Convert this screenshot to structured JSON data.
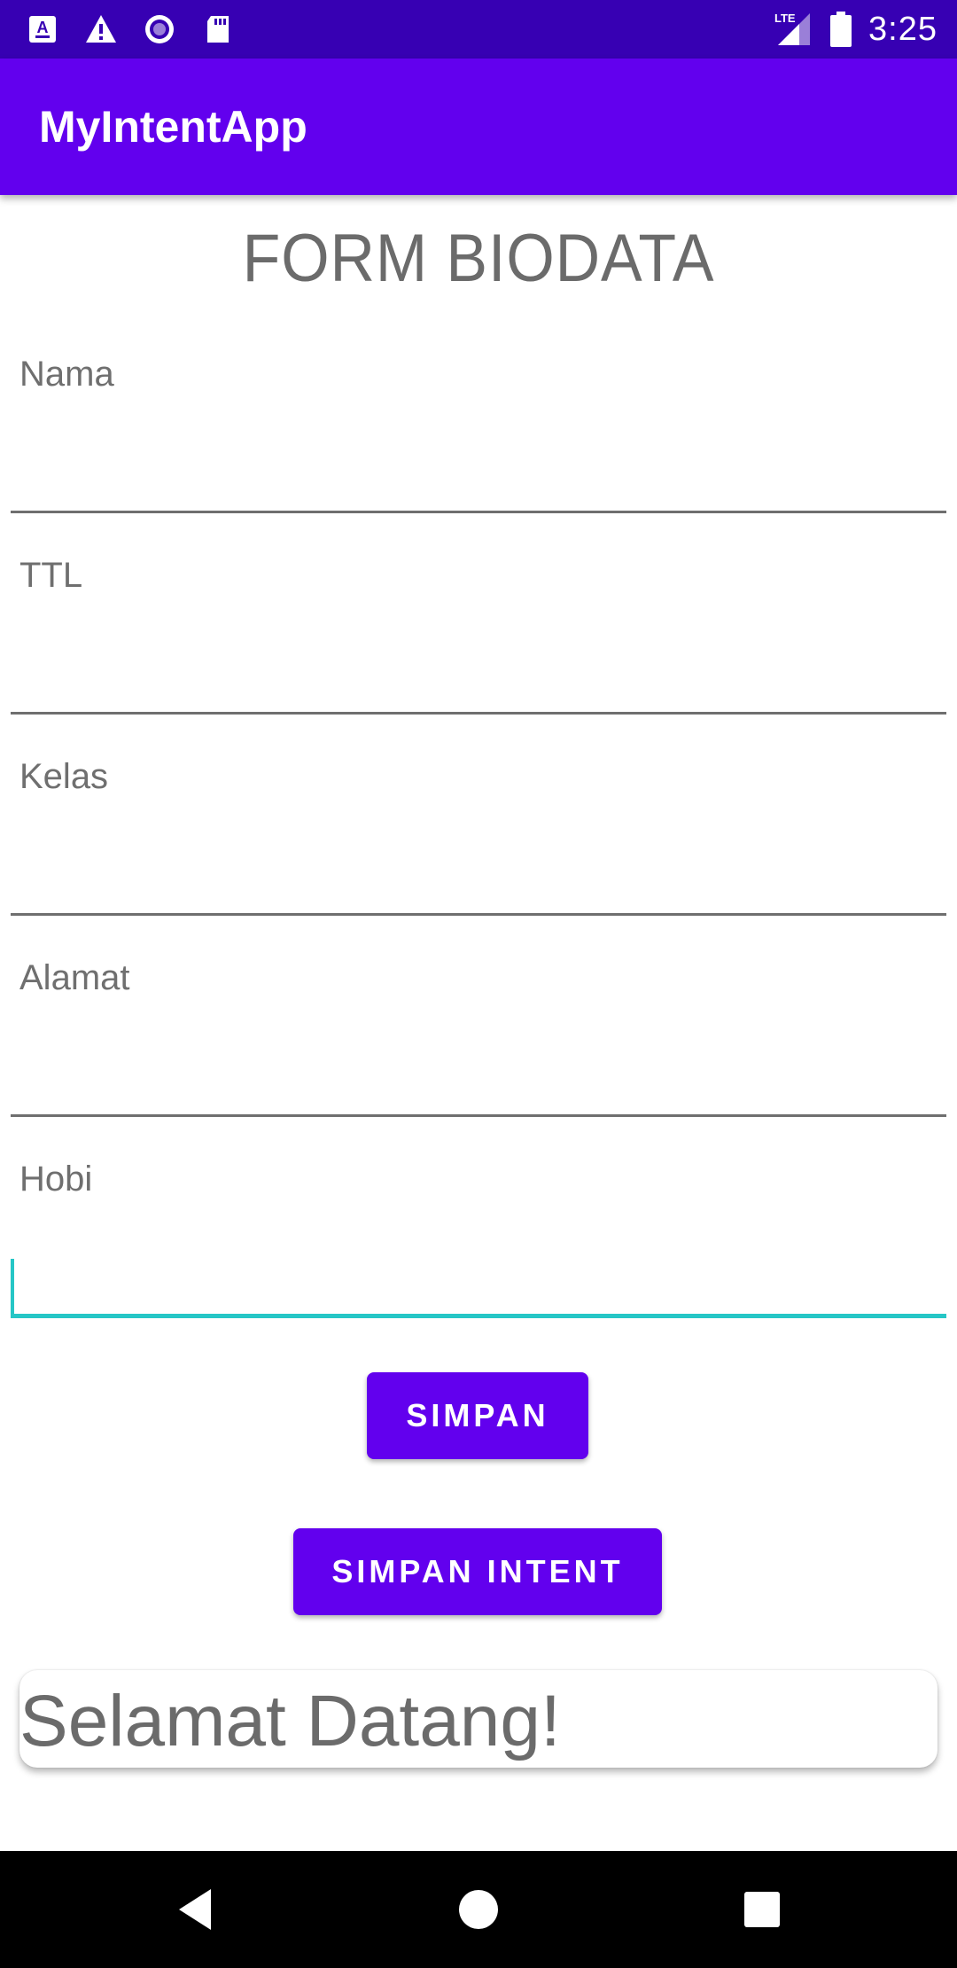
{
  "status_bar": {
    "time": "3:25",
    "network": "LTE",
    "left_icons": [
      "app-notification-icon",
      "warning-icon",
      "media-record-icon",
      "sd-card-icon"
    ],
    "right_icons": [
      "lte-signal-icon",
      "battery-icon"
    ],
    "background": "#3700b3"
  },
  "app_bar": {
    "title": "MyIntentApp",
    "background": "#6200ee"
  },
  "form": {
    "title": "FORM BIODATA",
    "fields": [
      {
        "label": "Nama",
        "value": ""
      },
      {
        "label": "TTL",
        "value": ""
      },
      {
        "label": "Kelas",
        "value": ""
      },
      {
        "label": "Alamat",
        "value": ""
      },
      {
        "label": "Hobi",
        "value": ""
      }
    ],
    "focused_field": "Hobi",
    "focus_color": "#26c6c6"
  },
  "buttons": {
    "save_label": "SIMPAN",
    "save_intent_label": "SIMPAN INTENT",
    "color": "#6200ee"
  },
  "welcome": {
    "text": "Selamat Datang!"
  },
  "nav_bar": {
    "buttons": [
      "back-icon",
      "home-icon",
      "recents-icon"
    ]
  }
}
